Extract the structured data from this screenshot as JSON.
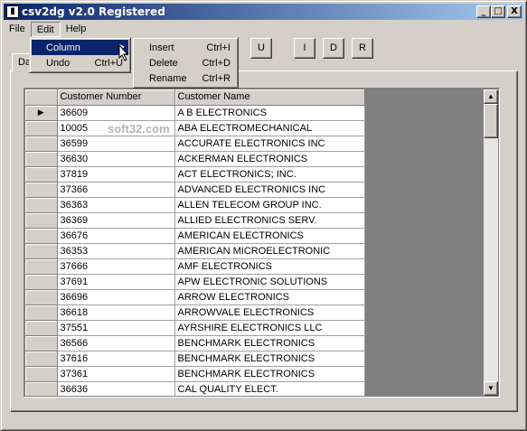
{
  "window": {
    "title": "csv2dg v2.0 Registered",
    "icon": "app-icon",
    "controls": [
      "_",
      "□",
      "X"
    ]
  },
  "menubar": {
    "items": [
      "File",
      "Edit",
      "Help"
    ]
  },
  "toolbar": {
    "buttons": [
      "U",
      "I",
      "D",
      "R"
    ]
  },
  "edit_menu": {
    "items": [
      {
        "label": "Column",
        "shortcut": ""
      },
      {
        "label": "Undo",
        "shortcut": "Ctrl+U"
      }
    ]
  },
  "column_submenu": {
    "items": [
      {
        "label": "Insert",
        "shortcut": "Ctrl+I"
      },
      {
        "label": "Delete",
        "shortcut": "Ctrl+D"
      },
      {
        "label": "Rename",
        "shortcut": "Ctrl+R"
      }
    ]
  },
  "tab": {
    "label": "Da"
  },
  "watermark": "soft32.com",
  "grid": {
    "columns": [
      "Customer Number",
      "Customer Name"
    ],
    "current_row_indicator": "▶",
    "rows": [
      [
        "36609",
        "A B ELECTRONICS"
      ],
      [
        "10005",
        "ABA ELECTROMECHANICAL"
      ],
      [
        "36599",
        "ACCURATE ELECTRONICS INC"
      ],
      [
        "36630",
        "ACKERMAN ELECTRONICS"
      ],
      [
        "37819",
        "ACT ELECTRONICS; INC."
      ],
      [
        "37366",
        "ADVANCED ELECTRONICS INC"
      ],
      [
        "36363",
        "ALLEN TELECOM GROUP INC."
      ],
      [
        "36369",
        "ALLIED ELECTRONICS SERV."
      ],
      [
        "36676",
        "AMERICAN ELECTRONICS"
      ],
      [
        "36353",
        "AMERICAN MICROELECTRONIC"
      ],
      [
        "37666",
        "AMF ELECTRONICS"
      ],
      [
        "37691",
        "APW ELECTRONIC SOLUTIONS"
      ],
      [
        "36696",
        "ARROW ELECTRONICS"
      ],
      [
        "36618",
        "ARROWVALE ELECTRONICS"
      ],
      [
        "37551",
        "AYRSHIRE ELECTRONICS LLC"
      ],
      [
        "36566",
        "BENCHMARK ELECTRONICS"
      ],
      [
        "37616",
        "BENCHMARK ELECTRONICS"
      ],
      [
        "37361",
        "BENCHMARK ELECTRONICS"
      ],
      [
        "36636",
        "CAL QUALITY ELECT."
      ]
    ]
  },
  "scrollbar": {
    "up": "▲",
    "down": "▼"
  },
  "colors": {
    "titlebar_start": "#0a246a",
    "titlebar_end": "#a6caf0",
    "face": "#d4d0c8",
    "highlight": "#0a246a"
  }
}
